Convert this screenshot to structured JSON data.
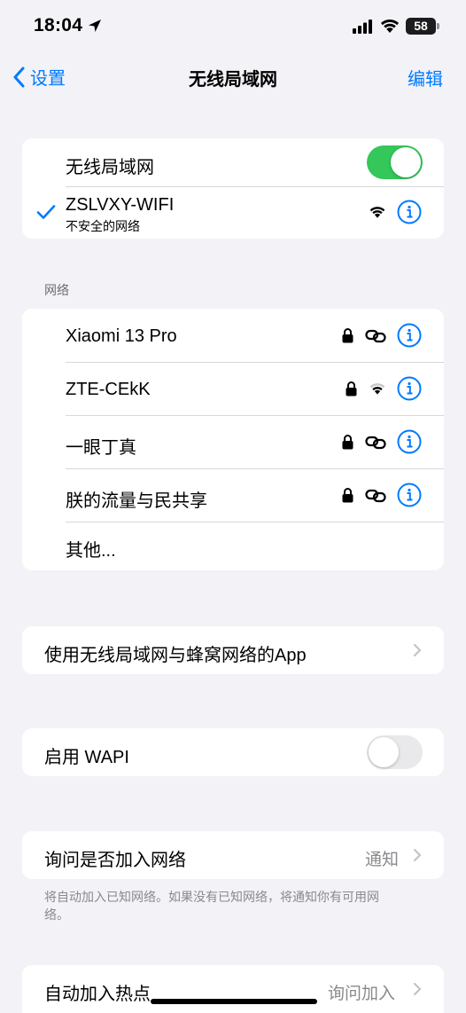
{
  "status_bar": {
    "time": "18:04",
    "battery": "58"
  },
  "nav": {
    "back_label": "设置",
    "title": "无线局域网",
    "edit_label": "编辑"
  },
  "wifi_card": {
    "toggle_label": "无线局域网",
    "toggle_on": true,
    "connected_name": "ZSLVXY-WIFI",
    "connected_sub": "不安全的网络"
  },
  "networks_section": {
    "header": "网络",
    "items": [
      {
        "name": "Xiaomi 13 Pro",
        "lock": true,
        "signal": "hotspot-link-icon"
      },
      {
        "name": "ZTE-CEkK",
        "lock": true,
        "signal": "wifi-weak-icon"
      },
      {
        "name": "一眼丁真",
        "lock": true,
        "signal": "hotspot-link-icon"
      },
      {
        "name": "朕的流量与民共享",
        "lock": true,
        "signal": "hotspot-link-icon"
      }
    ],
    "other_label": "其他..."
  },
  "apps_row": {
    "label": "使用无线局域网与蜂窝网络的App"
  },
  "wapi_row": {
    "label": "启用 WAPI",
    "toggle_on": false
  },
  "ask_join": {
    "label": "询问是否加入网络",
    "value": "通知",
    "footnote": "将自动加入已知网络。如果没有已知网络，将通知你有可用网络。"
  },
  "hotspot_row": {
    "label": "自动加入热点",
    "value": "询问加入"
  },
  "colors": {
    "accent": "#007aff",
    "toggle_on": "#34c759",
    "background": "#f2f2f7"
  }
}
